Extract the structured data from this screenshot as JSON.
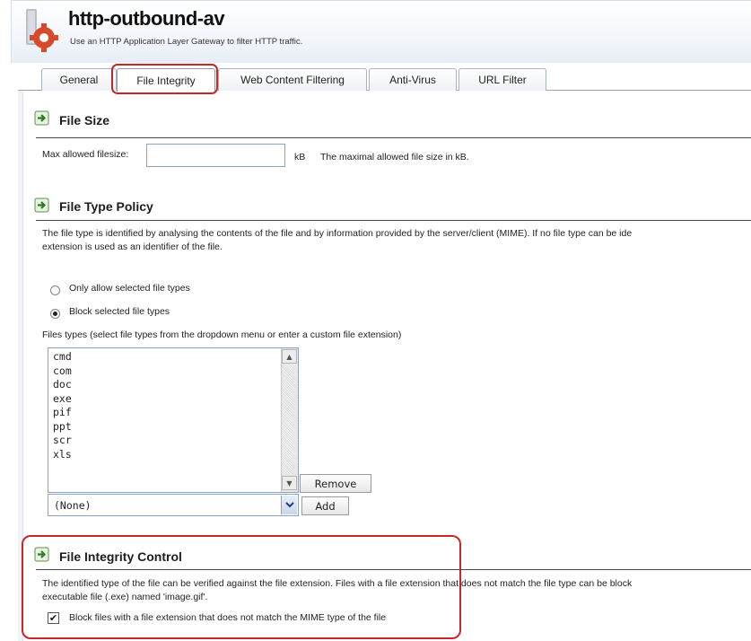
{
  "header": {
    "title": "http-outbound-av",
    "subtitle": "Use an HTTP Application Layer Gateway to filter HTTP traffic."
  },
  "tabs": [
    {
      "label": "General"
    },
    {
      "label": "File Integrity",
      "active": true
    },
    {
      "label": "Web Content Filtering"
    },
    {
      "label": "Anti-Virus"
    },
    {
      "label": "URL Filter"
    }
  ],
  "file_size": {
    "title": "File Size",
    "field_label": "Max allowed filesize:",
    "value": "",
    "unit": "kB",
    "help": "The maximal allowed file size in kB."
  },
  "file_type_policy": {
    "title": "File Type Policy",
    "description_line1": "The file type is identified by analysing the contents of the file and by information provided by the server/client (MIME). If no file type can be ide",
    "description_line2": "extension is used as an identifier of the file.",
    "radio_only_allow": "Only allow selected file types",
    "radio_block": "Block selected file types",
    "selected_mode": "block",
    "files_types_label": "Files types (select file types from the dropdown menu or enter a custom file extension)",
    "file_types": [
      "cmd",
      "com",
      "doc",
      "exe",
      "pif",
      "ppt",
      "scr",
      "xls"
    ],
    "remove_label": "Remove",
    "dropdown_value": "(None)",
    "add_label": "Add"
  },
  "file_integrity_control": {
    "title": "File Integrity Control",
    "description_line1": "The identified type of the file can be verified against the file extension. Files with a file extension that does not match the file type can be block",
    "description_line2": "executable file (.exe) named 'image.gif'.",
    "checkbox_label": "Block files with a file extension that does not match the MIME type of the file",
    "checkbox_checked": true
  },
  "colors": {
    "highlight": "#c62828",
    "section_icon": "#3a8a2e"
  }
}
